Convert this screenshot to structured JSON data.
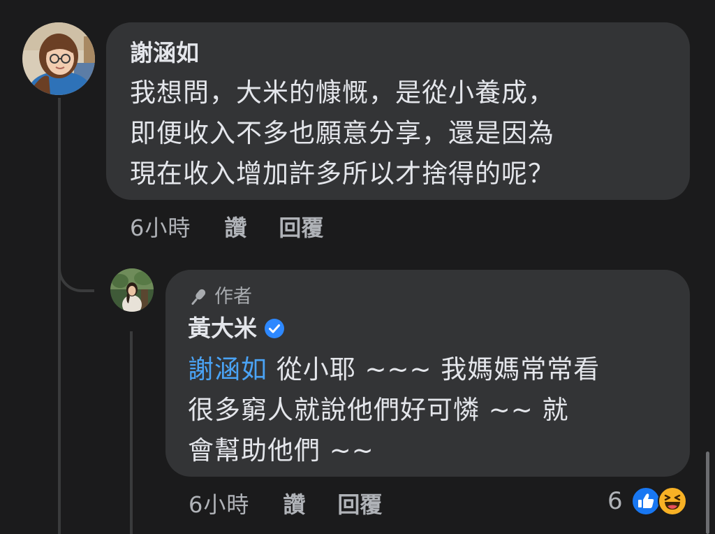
{
  "comment": {
    "author": "謝涵如",
    "text_lines": [
      "我想問，大米的慷慨，是從小養成，",
      "即便收入不多也願意分享，還是因為",
      "現在收入增加許多所以才捨得的呢？"
    ],
    "time": "6小時",
    "like_label": "讚",
    "reply_label": "回覆"
  },
  "reply": {
    "badge_icon": "microphone-icon",
    "badge": "作者",
    "author": "黃大米",
    "verified_icon": "verified-badge-icon",
    "mention": "謝涵如",
    "text_first": "從小耶 ~~~ 我媽媽常常看",
    "text_lines": [
      "很多窮人就說他們好可憐 ~~ 就",
      "會幫助他們 ~~"
    ],
    "time": "6小時",
    "like_label": "讚",
    "reply_label": "回覆",
    "reaction_count": "6",
    "reaction_icons": [
      "like-reaction-icon",
      "haha-reaction-icon"
    ]
  },
  "colors": {
    "background": "#1b1b1c",
    "bubble": "#333436",
    "mention": "#4aa3f5",
    "like_blue": "#1877f2",
    "haha_yellow": "#f7b125"
  }
}
